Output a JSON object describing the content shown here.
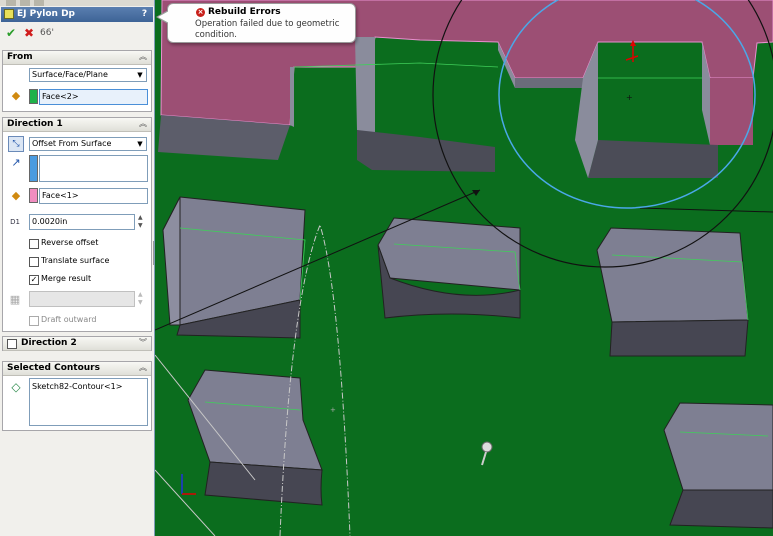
{
  "feature": {
    "title": "EJ Pylon Dp",
    "help": "?"
  },
  "actions": {
    "ok": "✔",
    "cancel": "✖",
    "preview": "66'"
  },
  "from": {
    "title": "From",
    "type_value": "Surface/Face/Plane",
    "face_value": "Face<2>",
    "color": "#1fb24a"
  },
  "direction1": {
    "title": "Direction 1",
    "end_condition": "Offset From Surface",
    "offset_face": "Face<1>",
    "offset_face_color": "#f08dc0",
    "direction_color": "#4a9be0",
    "offset_value": "0.0020in",
    "d1_label": "D1",
    "reverse_offset": "Reverse offset",
    "translate_surface": "Translate surface",
    "merge_result": "Merge result",
    "draft_outward": "Draft outward"
  },
  "direction2": {
    "title": "Direction 2"
  },
  "selected_contours": {
    "title": "Selected Contours",
    "item": "Sketch82-Contour<1>"
  },
  "error": {
    "title": "Rebuild Errors",
    "message": "Operation failed due to geometric condition."
  },
  "colors": {
    "viewport_bg": "#0b6d1e",
    "highlight_face": "#9c4f74",
    "box_face": "#7e7f92",
    "selection_circle": "#4aa8e8"
  }
}
